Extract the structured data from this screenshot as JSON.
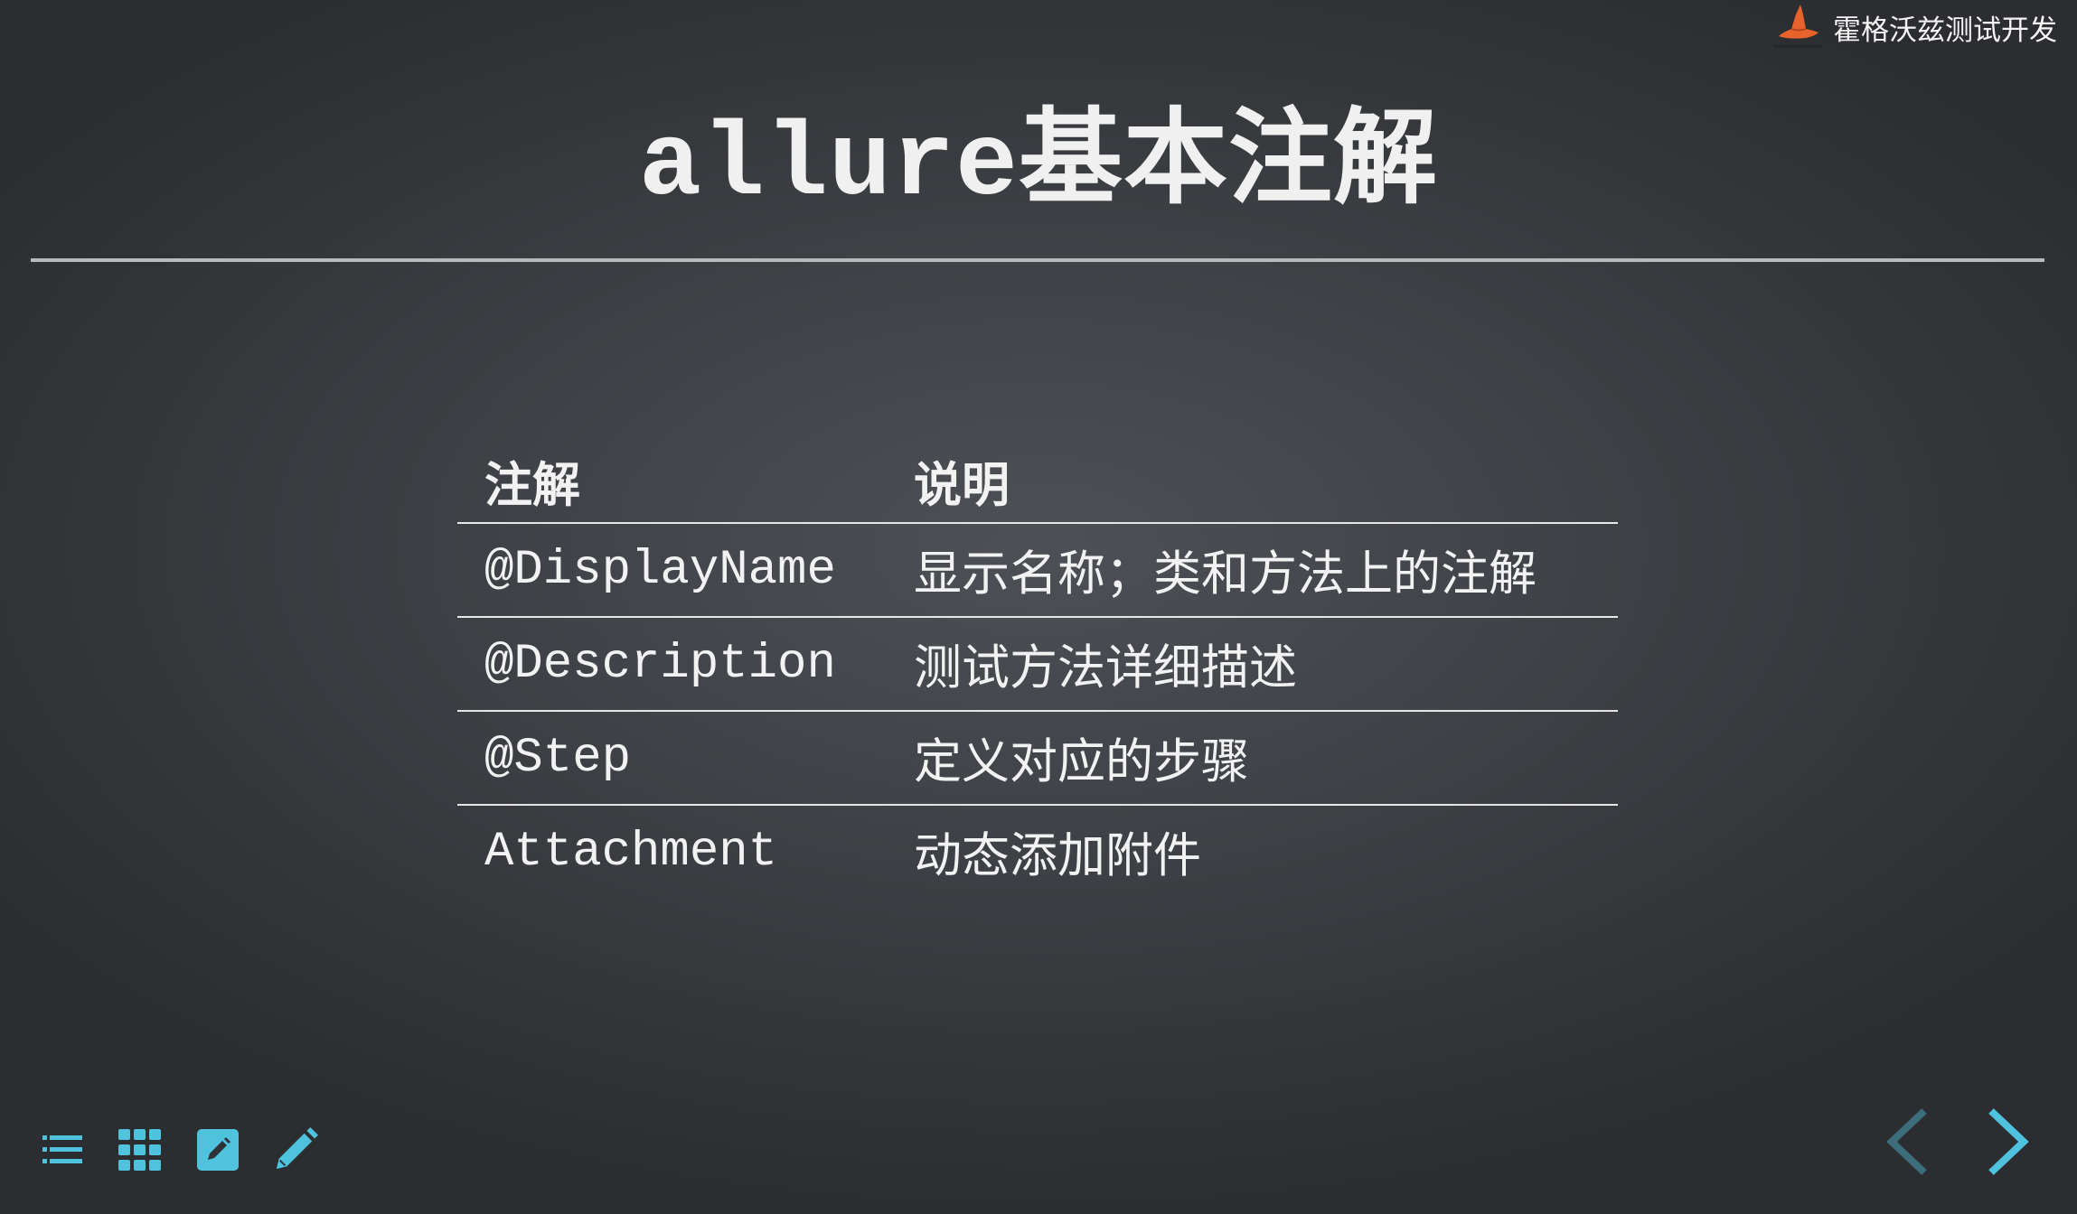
{
  "brand": {
    "name": "霍格沃兹测试开发"
  },
  "slide": {
    "title_mono": "allure",
    "title_cjk": "基本注解"
  },
  "table": {
    "headers": [
      "注解",
      "说明"
    ],
    "rows": [
      {
        "annotation": "@DisplayName",
        "description": "显示名称；类和方法上的注解"
      },
      {
        "annotation": "@Description",
        "description": "测试方法详细描述"
      },
      {
        "annotation": "@Step",
        "description": "定义对应的步骤"
      },
      {
        "annotation": "Attachment",
        "description": "动态添加附件"
      }
    ]
  },
  "toolbar": {
    "items": [
      "menu-icon",
      "grid-icon",
      "edit-box-icon",
      "pencil-icon"
    ]
  },
  "navigation": {
    "prev": "chevron-left-icon",
    "next": "chevron-right-icon"
  },
  "colors": {
    "accent": "#4fc3dd",
    "accent_dim": "#3d6d7a",
    "logo_orange": "#e8632b",
    "text": "#f2f2f2",
    "rule": "#b9babb"
  }
}
